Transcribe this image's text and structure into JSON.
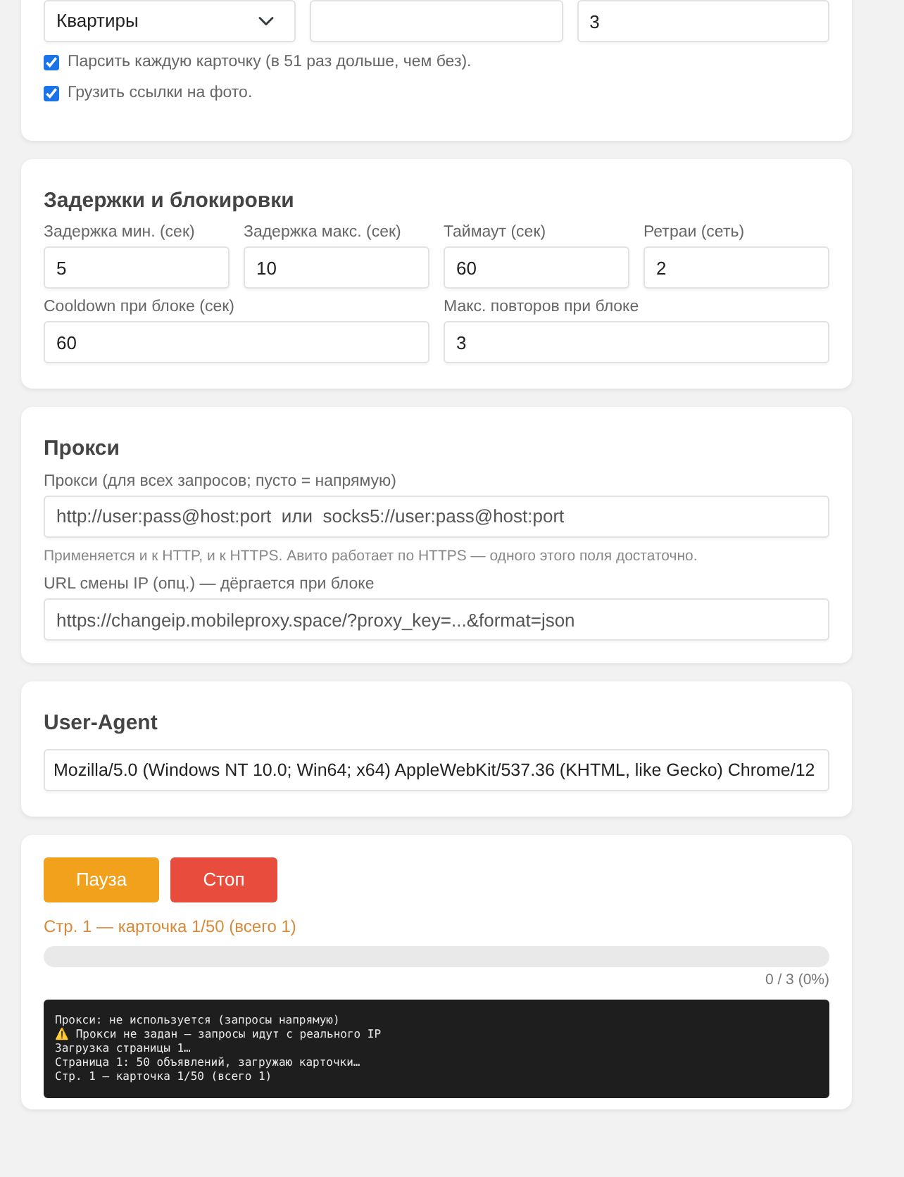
{
  "search_card": {
    "fields": [
      {
        "kind": "select",
        "value": "Квартиры"
      },
      {
        "kind": "input"
      },
      {
        "kind": "input",
        "value": "3"
      }
    ],
    "options": [
      {
        "label": "Парсить каждую карточку (в 51 раз дольше, чем без).",
        "checked": true
      },
      {
        "label": "Грузить ссылки на фото.",
        "checked": true
      }
    ]
  },
  "delays_card": {
    "title": "Задержки и блокировки",
    "fields": [
      {
        "label": "Задержка мин. (сек)",
        "value": "5"
      },
      {
        "label": "Задержка макс. (сек)",
        "value": "10"
      },
      {
        "label": "Таймаут (сек)",
        "value": "60"
      },
      {
        "label": "Ретраи (сеть)",
        "value": "2"
      },
      {
        "label": "Cooldown при блоке (сек)",
        "value": "60"
      },
      {
        "label": "Макс. повторов при блоке",
        "value": "3"
      }
    ]
  },
  "proxy_card": {
    "title": "Прокси",
    "proxy_label": "Прокси (для всех запросов; пусто = напрямую)",
    "proxy_placeholder": "http://user:pass@host:port  или  socks5://user:pass@host:port",
    "hint": "Применяется и к HTTP, и к HTTPS. Авито работает по HTTPS — одного этого поля достаточно.",
    "ip_label": "URL смены IP (опц.) — дёргается при блоке",
    "ip_placeholder": "https://changeip.mobileproxy.space/?proxy_key=...&format=json"
  },
  "ua_card": {
    "title": "User-Agent",
    "value": "Mozilla/5.0 (Windows NT 10.0; Win64; x64) AppleWebKit/537.36 (KHTML, like Gecko) Chrome/12"
  },
  "run_card": {
    "buttons": [
      {
        "label": "Пауза",
        "kind": "pause"
      },
      {
        "label": "Стоп",
        "kind": "stop"
      }
    ],
    "status": "Стр. 1 — карточка 1/50 (всего 1)",
    "progress": {
      "level": 0,
      "reading": "0 / 3 (0%)"
    },
    "log": [
      "Прокси: не используется (запросы напрямую)",
      "⚠️ Прокси не задан — запросы идут с реального IP",
      "Загрузка страницы 1…",
      "Страница 1: 50 объявлений, загружаю карточки…",
      "Стр. 1 — карточка 1/50 (всего 1)"
    ]
  }
}
